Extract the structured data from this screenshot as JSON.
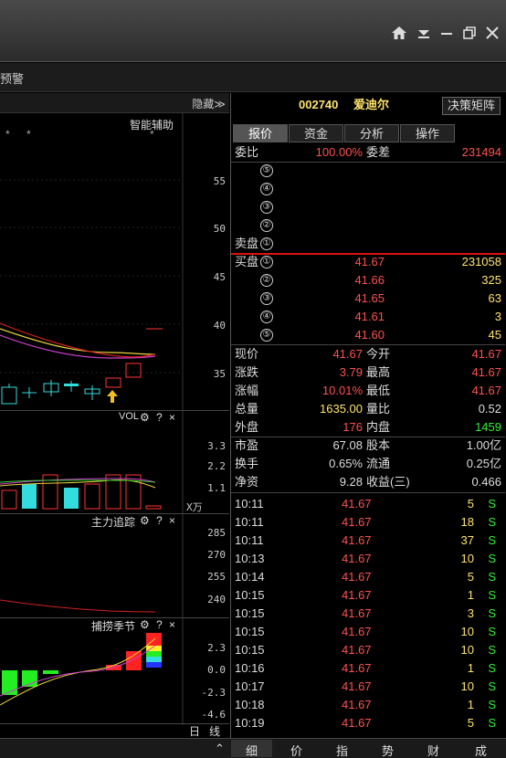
{
  "window": {
    "controls": [
      "home-icon",
      "dropdown-icon",
      "minimize-icon",
      "restore-icon",
      "close-icon"
    ]
  },
  "toolbar": {
    "left_text": "预警"
  },
  "chart": {
    "hide_label": "隐藏≫",
    "assist_label": "智能辅助",
    "price_axis": [
      "55",
      "50",
      "45",
      "40",
      "35"
    ],
    "markers": [
      "*",
      "*",
      "*",
      "*"
    ],
    "vol": {
      "title": "VOL",
      "axis": [
        "3.3",
        "2.2",
        "1.1"
      ],
      "unit": "X万"
    },
    "main": {
      "title": "主力追踪",
      "axis": [
        "285",
        "270",
        "255",
        "240"
      ]
    },
    "season": {
      "title": "捕捞季节",
      "axis": [
        "2.3",
        "0.0",
        "-2.3",
        "-4.6"
      ]
    },
    "period_buttons": [
      "日",
      "线"
    ],
    "icon_labels": {
      "gear": "⚙",
      "help": "?",
      "close": "×"
    }
  },
  "quote": {
    "code": "002740",
    "name": "爱迪尔",
    "decision_btn": "决策矩阵",
    "tabs": [
      "报价",
      "资金",
      "分析",
      "操作"
    ],
    "weibi_label": "委比",
    "weibi": "100.00%",
    "weicha_label": "委差",
    "weicha": "231494",
    "sell_label": "卖盘",
    "sell_levels": [
      "⑤",
      "④",
      "③",
      "②",
      "①"
    ],
    "buy_label": "买盘",
    "buys": [
      {
        "lvl": "①",
        "price": "41.67",
        "vol": "231058"
      },
      {
        "lvl": "②",
        "price": "41.66",
        "vol": "325"
      },
      {
        "lvl": "③",
        "price": "41.65",
        "vol": "63"
      },
      {
        "lvl": "④",
        "price": "41.61",
        "vol": "3"
      },
      {
        "lvl": "⑤",
        "price": "41.60",
        "vol": "45"
      }
    ],
    "stats": [
      {
        "l1": "现价",
        "v1": "41.67",
        "l2": "今开",
        "v2": "41.67"
      },
      {
        "l1": "涨跌",
        "v1": "3.79",
        "l2": "最高",
        "v2": "41.67"
      },
      {
        "l1": "涨幅",
        "v1": "10.01%",
        "l2": "最低",
        "v2": "41.67"
      },
      {
        "l1": "总量",
        "v1": "1635.00",
        "l2": "量比",
        "v2": "0.52"
      },
      {
        "l1": "外盘",
        "v1": "176",
        "l2": "内盘",
        "v2": "1459"
      }
    ],
    "fundamentals": [
      {
        "l1": "市盈",
        "v1": "67.08",
        "l2": "股本",
        "v2": "1.00亿"
      },
      {
        "l1": "换手",
        "v1": "0.65%",
        "l2": "流通",
        "v2": "0.25亿"
      },
      {
        "l1": "净资",
        "v1": "9.28",
        "l2": "收益(三)",
        "v2": "0.466"
      }
    ],
    "ticks": [
      {
        "t": "10:11",
        "p": "41.67",
        "v": "5",
        "s": "S"
      },
      {
        "t": "10:11",
        "p": "41.67",
        "v": "18",
        "s": "S"
      },
      {
        "t": "10:11",
        "p": "41.67",
        "v": "37",
        "s": "S"
      },
      {
        "t": "10:13",
        "p": "41.67",
        "v": "10",
        "s": "S"
      },
      {
        "t": "10:14",
        "p": "41.67",
        "v": "5",
        "s": "S"
      },
      {
        "t": "10:15",
        "p": "41.67",
        "v": "1",
        "s": "S"
      },
      {
        "t": "10:15",
        "p": "41.67",
        "v": "3",
        "s": "S"
      },
      {
        "t": "10:15",
        "p": "41.67",
        "v": "10",
        "s": "S"
      },
      {
        "t": "10:15",
        "p": "41.67",
        "v": "10",
        "s": "S"
      },
      {
        "t": "10:16",
        "p": "41.67",
        "v": "1",
        "s": "S"
      },
      {
        "t": "10:17",
        "p": "41.67",
        "v": "10",
        "s": "S"
      },
      {
        "t": "10:18",
        "p": "41.67",
        "v": "1",
        "s": "S"
      },
      {
        "t": "10:19",
        "p": "41.67",
        "v": "5",
        "s": "S"
      }
    ],
    "bottom_tabs": [
      "细",
      "价",
      "指",
      "势",
      "财",
      "成"
    ],
    "bottom_left": [
      "≈"
    ]
  }
}
